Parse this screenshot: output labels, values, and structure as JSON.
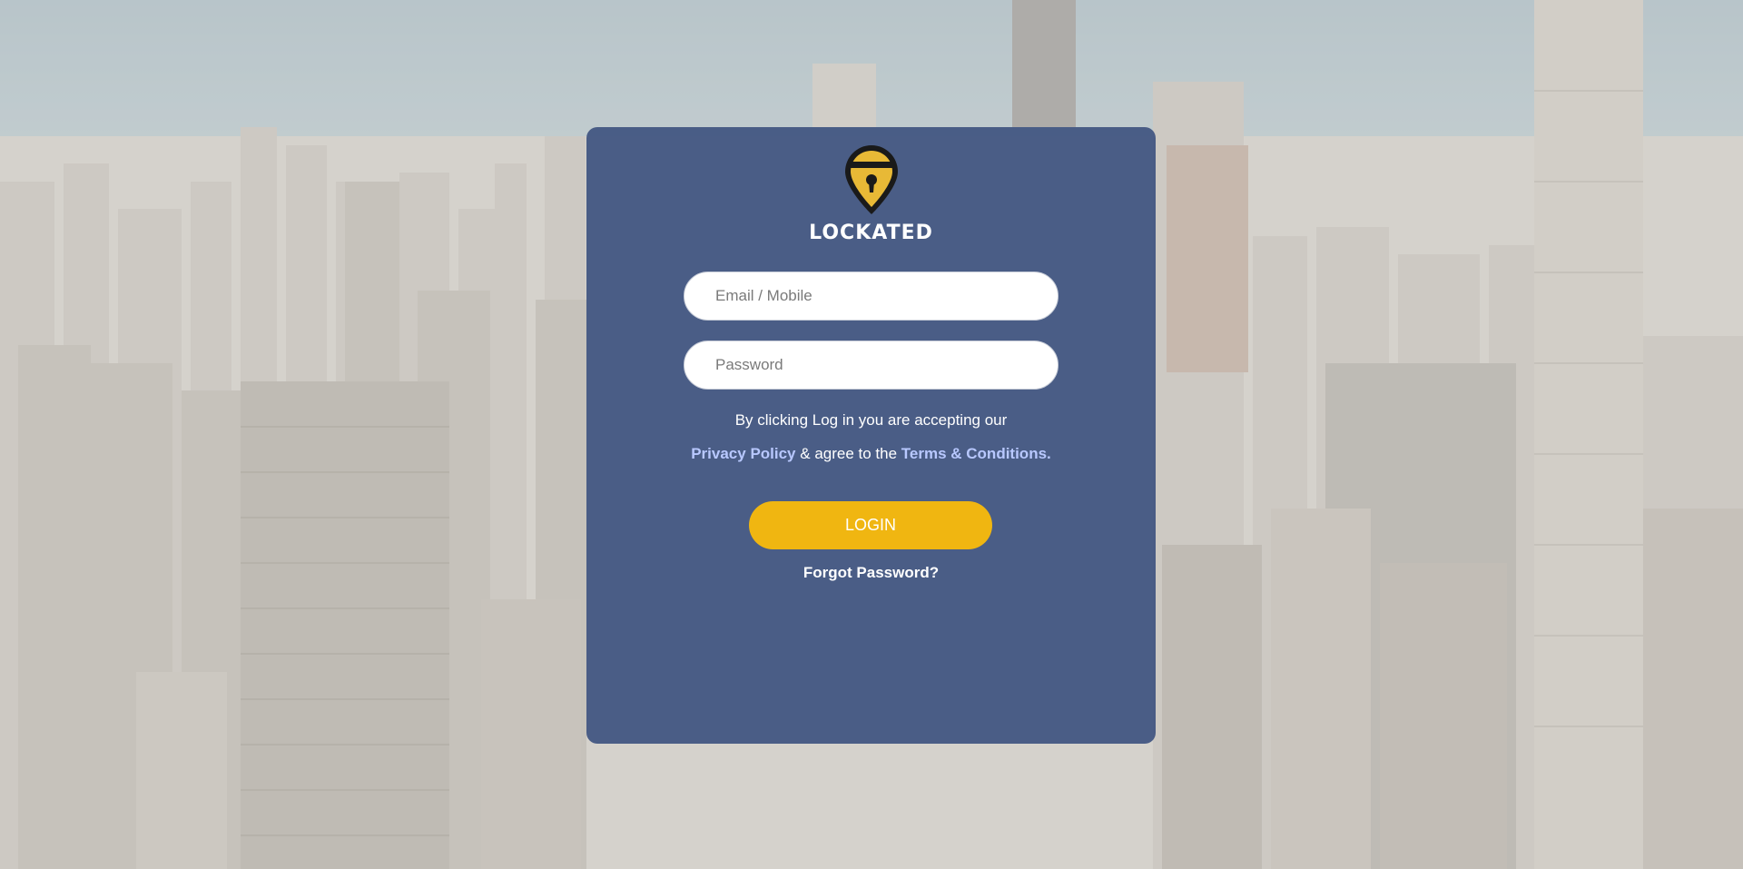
{
  "brand": {
    "name": "LOCKATED",
    "icon": "keyhole-pin-icon",
    "colors": {
      "accent": "#f0b611",
      "card": "#405480",
      "link": "#b8c8ff"
    }
  },
  "form": {
    "email_placeholder": "Email / Mobile",
    "password_placeholder": "Password",
    "login_label": "LOGIN",
    "forgot_label": "Forgot Password?"
  },
  "terms": {
    "line1": "By clicking Log in you are accepting our",
    "privacy_label": "Privacy Policy",
    "middle": " & agree to the ",
    "terms_label": "Terms & Conditions."
  },
  "background": {
    "image": "city-skyline-background"
  }
}
